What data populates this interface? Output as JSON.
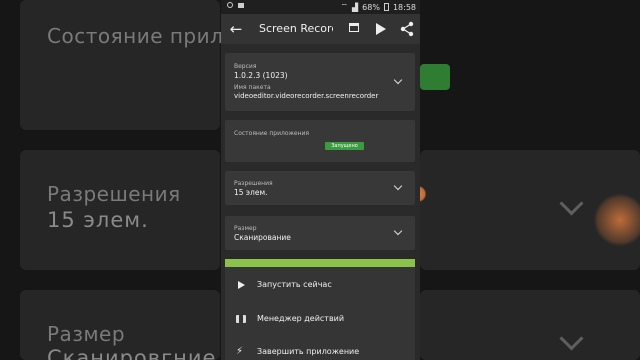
{
  "background": {
    "state_title": "Состояние приложе",
    "permissions_title": "Разрешения",
    "permissions_value": "15 элем.",
    "size_title": "Размер",
    "size_value": "Сканировгние"
  },
  "statusbar": {
    "battery": "68%",
    "time": "18:58"
  },
  "toolbar": {
    "title": "Screen Recorder"
  },
  "version_card": {
    "label": "Версия",
    "value": "1.0.2.3 (1023)",
    "package_label": "Имя пакета",
    "package_value": "videoeditor.videorecorder.screenrecorder"
  },
  "state_card": {
    "label": "Состояние приложения",
    "badge": "Запущено"
  },
  "permissions_card": {
    "label": "Разрешения",
    "value": "15 элем."
  },
  "size_card": {
    "label": "Размер",
    "value": "Сканирование"
  },
  "menu": {
    "items": [
      {
        "label": "Запустить сейчас",
        "icon": "play-icon"
      },
      {
        "label": "Менеджер действий",
        "icon": "film-icon"
      },
      {
        "label": "Завершить приложение",
        "icon": "bolt-icon"
      }
    ]
  },
  "colors": {
    "accent_green": "#8bc34a",
    "badge_green": "#3c9a3f",
    "card_bg": "#383838"
  }
}
